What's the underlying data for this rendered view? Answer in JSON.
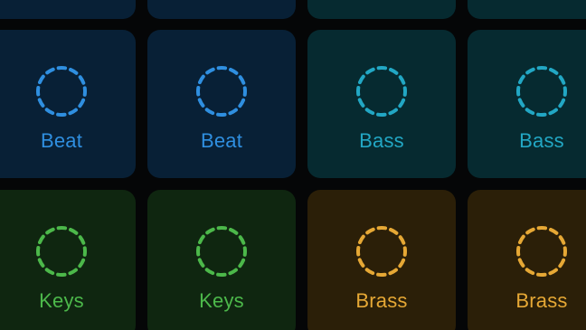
{
  "pads": [
    {
      "row": 0,
      "col": 0,
      "label": "",
      "color": "#2f8fe0",
      "bg": "#082036"
    },
    {
      "row": 0,
      "col": 1,
      "label": "",
      "color": "#2f8fe0",
      "bg": "#082036"
    },
    {
      "row": 0,
      "col": 2,
      "label": "",
      "color": "#22a7c4",
      "bg": "#062a30"
    },
    {
      "row": 0,
      "col": 3,
      "label": "",
      "color": "#22a7c4",
      "bg": "#062a30"
    },
    {
      "row": 1,
      "col": 0,
      "label": "Beat",
      "icon": "dashed-circle-icon",
      "color": "#2f8fe0",
      "bg": "#082036"
    },
    {
      "row": 1,
      "col": 1,
      "label": "Beat",
      "icon": "dashed-circle-icon",
      "color": "#2f8fe0",
      "bg": "#082036"
    },
    {
      "row": 1,
      "col": 2,
      "label": "Bass",
      "icon": "dashed-circle-icon",
      "color": "#22a7c4",
      "bg": "#062a30"
    },
    {
      "row": 1,
      "col": 3,
      "label": "Bass",
      "icon": "dashed-circle-icon",
      "color": "#22a7c4",
      "bg": "#062a30"
    },
    {
      "row": 2,
      "col": 0,
      "label": "Keys",
      "icon": "dashed-circle-icon",
      "color": "#4cb84a",
      "bg": "#0f2610"
    },
    {
      "row": 2,
      "col": 1,
      "label": "Keys",
      "icon": "dashed-circle-icon",
      "color": "#4cb84a",
      "bg": "#0f2610"
    },
    {
      "row": 2,
      "col": 2,
      "label": "Brass",
      "icon": "dashed-circle-icon",
      "color": "#e6a835",
      "bg": "#2b1f08"
    },
    {
      "row": 2,
      "col": 3,
      "label": "Brass",
      "icon": "dashed-circle-icon",
      "color": "#e6a835",
      "bg": "#2b1f08"
    }
  ]
}
